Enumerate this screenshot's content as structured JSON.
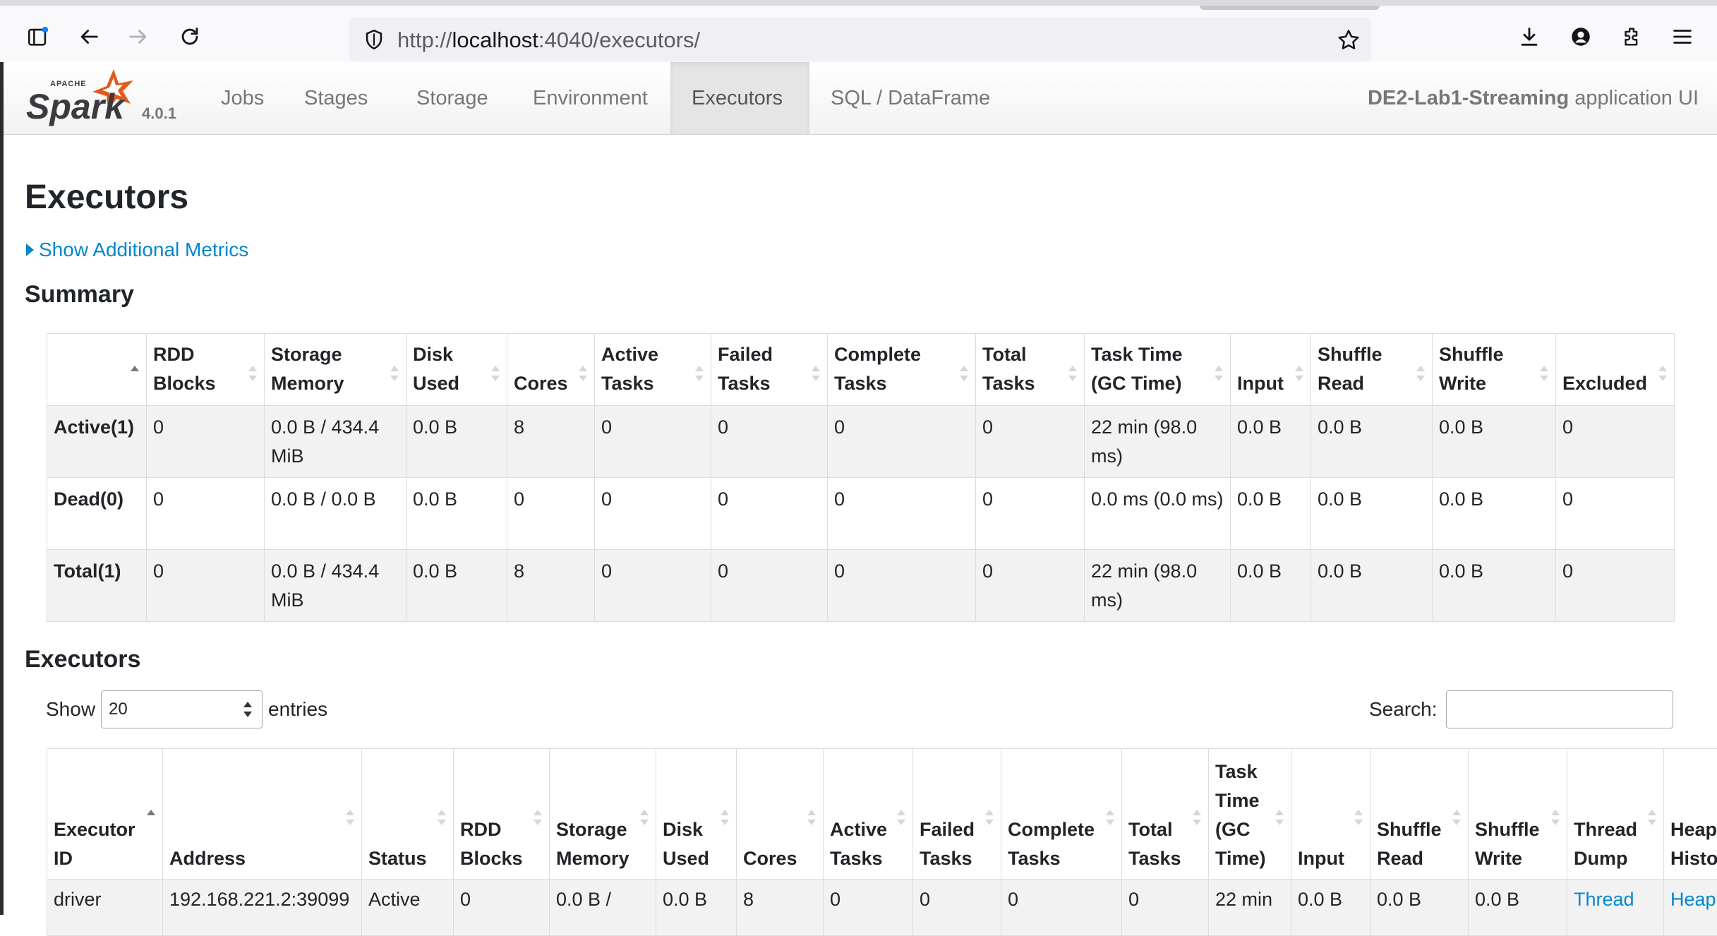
{
  "browser": {
    "url_prefix": "http://",
    "url_host": "localhost",
    "url_rest": ":4040/executors/"
  },
  "navbar": {
    "version": "4.0.1",
    "tabs": [
      {
        "label": "Jobs",
        "active": false
      },
      {
        "label": "Stages",
        "active": false
      },
      {
        "label": "Storage",
        "active": false
      },
      {
        "label": "Environment",
        "active": false
      },
      {
        "label": "Executors",
        "active": true
      },
      {
        "label": "SQL / DataFrame",
        "active": false
      }
    ],
    "app_name": "DE2-Lab1-Streaming",
    "app_suffix": "application UI"
  },
  "page": {
    "title": "Executors",
    "metrics_toggle": "Show Additional Metrics",
    "summary_heading": "Summary",
    "executors_heading": "Executors"
  },
  "summary": {
    "headers": [
      "",
      "RDD Blocks",
      "Storage Memory",
      "Disk Used",
      "Cores",
      "Active Tasks",
      "Failed Tasks",
      "Complete Tasks",
      "Total Tasks",
      "Task Time (GC Time)",
      "Input",
      "Shuffle Read",
      "Shuffle Write",
      "Excluded"
    ],
    "rows": [
      [
        "Active(1)",
        "0",
        "0.0 B / 434.4 MiB",
        "0.0 B",
        "8",
        "0",
        "0",
        "0",
        "0",
        "22 min (98.0 ms)",
        "0.0 B",
        "0.0 B",
        "0.0 B",
        "0"
      ],
      [
        "Dead(0)",
        "0",
        "0.0 B / 0.0 B",
        "0.0 B",
        "0",
        "0",
        "0",
        "0",
        "0",
        "0.0 ms (0.0 ms)",
        "0.0 B",
        "0.0 B",
        "0.0 B",
        "0"
      ],
      [
        "Total(1)",
        "0",
        "0.0 B / 434.4 MiB",
        "0.0 B",
        "8",
        "0",
        "0",
        "0",
        "0",
        "22 min (98.0 ms)",
        "0.0 B",
        "0.0 B",
        "0.0 B",
        "0"
      ]
    ]
  },
  "executors_table": {
    "show_label": "Show",
    "page_length": "20",
    "entries_label": "entries",
    "search_label": "Search:",
    "search_value": "",
    "headers": [
      "Executor ID",
      "Address",
      "Status",
      "RDD Blocks",
      "Storage Memory",
      "Disk Used",
      "Cores",
      "Active Tasks",
      "Failed Tasks",
      "Complete Tasks",
      "Total Tasks",
      "Task Time (GC Time)",
      "Input",
      "Shuffle Read",
      "Shuffle Write",
      "Thread Dump",
      "Heap Histogram"
    ],
    "rows": [
      {
        "executor_id": "driver",
        "address": "192.168.221.2:39099",
        "status": "Active",
        "rdd_blocks": "0",
        "storage_memory": "0.0 B /",
        "disk_used": "0.0 B",
        "cores": "8",
        "active_tasks": "0",
        "failed_tasks": "0",
        "complete_tasks": "0",
        "total_tasks": "0",
        "task_time": "22 min",
        "input": "0.0 B",
        "shuffle_read": "0.0 B",
        "shuffle_write": "0.0 B",
        "thread_dump": "Thread",
        "heap_histogram": "Heap"
      }
    ]
  }
}
